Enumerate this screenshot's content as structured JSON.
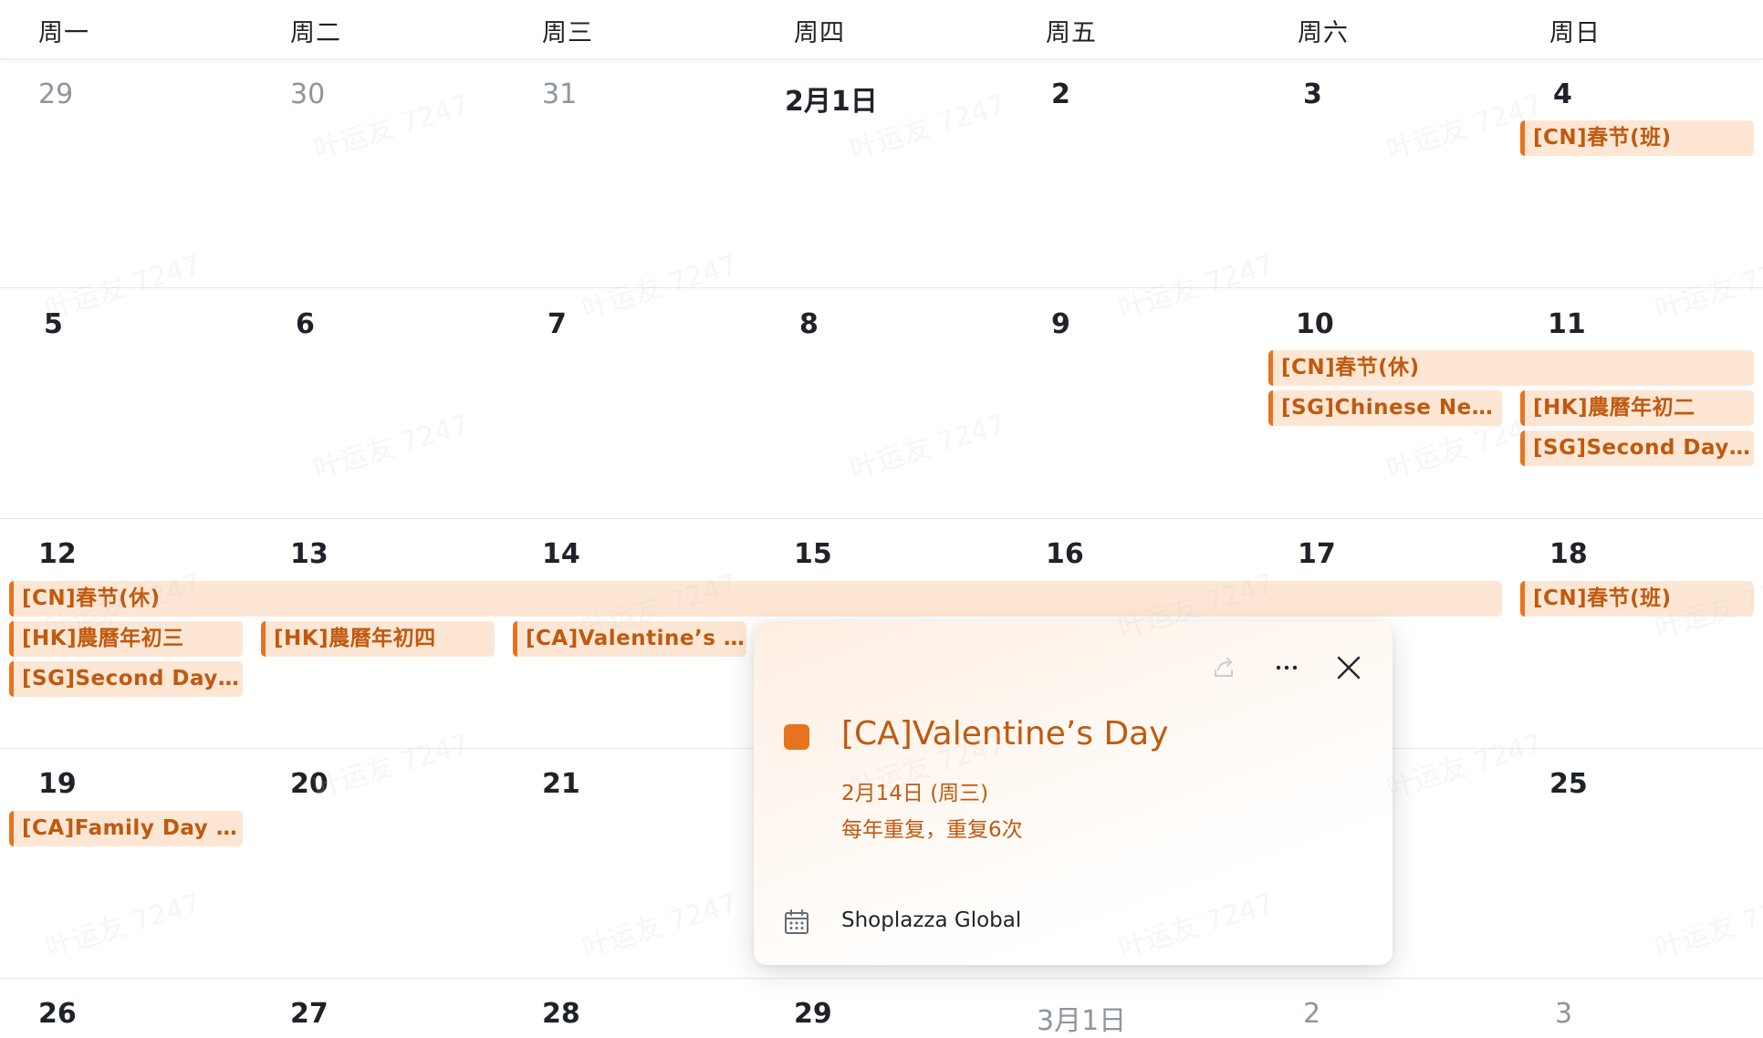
{
  "weekdays": [
    "周一",
    "周二",
    "周三",
    "周四",
    "周五",
    "周六",
    "周日"
  ],
  "weeks": [
    {
      "days": [
        "29",
        "30",
        "31",
        "2月1日",
        "2",
        "3",
        "4"
      ],
      "muted": [
        true,
        true,
        true,
        false,
        false,
        false,
        false
      ]
    },
    {
      "days": [
        "5",
        "6",
        "7",
        "8",
        "9",
        "10",
        "11"
      ],
      "muted": [
        false,
        false,
        false,
        false,
        false,
        false,
        false
      ]
    },
    {
      "days": [
        "12",
        "13",
        "14",
        "15",
        "16",
        "17",
        "18"
      ],
      "muted": [
        false,
        false,
        false,
        false,
        false,
        false,
        false
      ]
    },
    {
      "days": [
        "19",
        "20",
        "21",
        "",
        "",
        "",
        "25"
      ],
      "muted": [
        false,
        false,
        false,
        false,
        false,
        false,
        false
      ]
    },
    {
      "days": [
        "26",
        "27",
        "28",
        "29",
        "3月1日",
        "2",
        "3"
      ],
      "muted": [
        false,
        false,
        false,
        false,
        true,
        true,
        true
      ]
    }
  ],
  "events": [
    {
      "label": "[CN]春节(班)"
    },
    {
      "label": "[CN]春节(休)"
    },
    {
      "label": "[SG]Chinese New ..."
    },
    {
      "label": "[HK]農曆年初二"
    },
    {
      "label": "[SG]Second Day o..."
    },
    {
      "label": "[CN]春节(休)"
    },
    {
      "label": "[CN]春节(班)"
    },
    {
      "label": "[HK]農曆年初三"
    },
    {
      "label": "[HK]農曆年初四"
    },
    {
      "label": "[CA]Valentine’s Day"
    },
    {
      "label": "[SG]Second Day o..."
    },
    {
      "label": "[CA]Family Day (A..."
    }
  ],
  "popover": {
    "title": "[CA]Valentine’s Day",
    "date": "2月14日 (周三)",
    "repeat": "每年重复，重复6次",
    "calendar": "Shoplazza Global",
    "color": "#e8731f",
    "icons": [
      "share-icon",
      "more-icon",
      "close-icon",
      "calendar-icon"
    ]
  },
  "watermark": "叶运友 7247",
  "colors": {
    "event_bg": "#fde7d4",
    "event_accent": "#e8731f",
    "event_text": "#c0590f"
  }
}
